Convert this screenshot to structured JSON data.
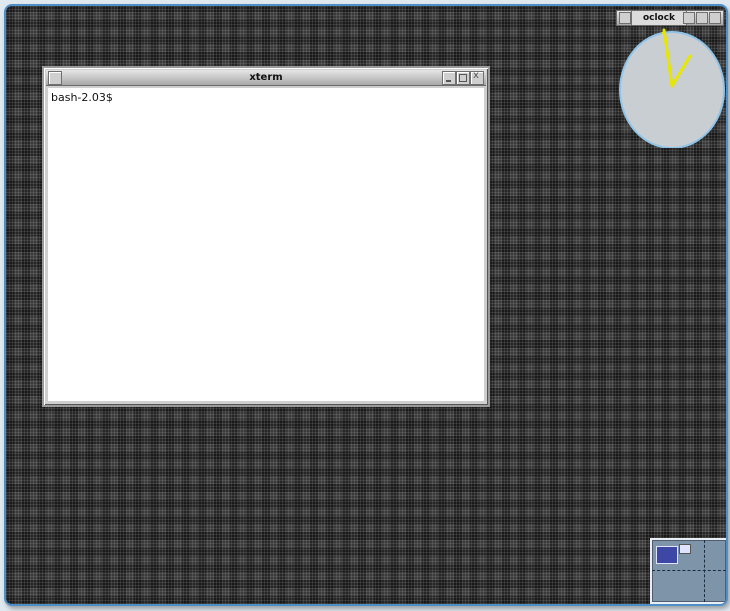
{
  "xterm": {
    "title": "xterm",
    "prompt": "bash-2.03$",
    "buttons": [
      "window-menu-icon",
      "minimize-icon",
      "maximize-icon",
      "close-icon"
    ]
  },
  "oclock": {
    "title": "oclock",
    "face_color": "#c9ced2",
    "hand_color": "#e6e600"
  },
  "pager": {
    "background_color": "#7e94a8",
    "window_color": "#3d48a5"
  },
  "desktop": {
    "border_color": "#4f8fc8"
  }
}
